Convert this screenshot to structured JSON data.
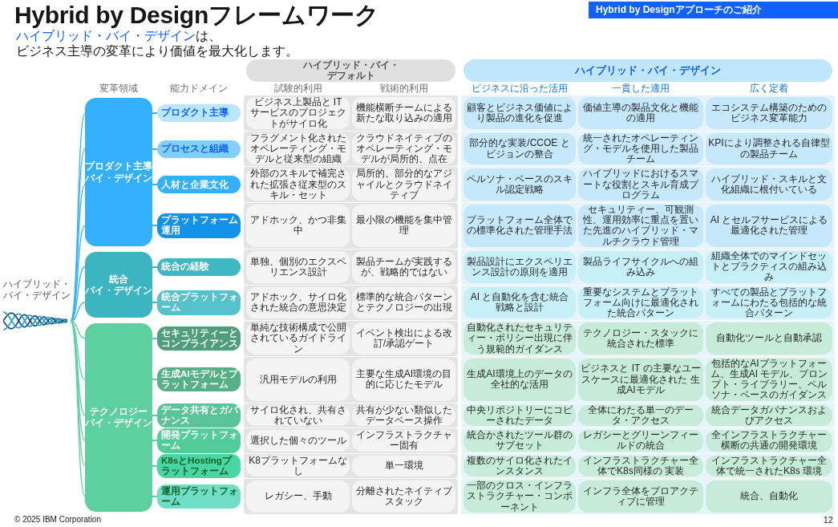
{
  "banner": "Hybrid by Designアプローチのご紹介",
  "title": "Hybrid by Designフレームワーク",
  "subtitle": {
    "emphasis": "ハイブリッド・バイ・デザイン",
    "rest": "は、",
    "line_2": "ビジネス主導の変革により価値を最大化します。"
  },
  "framework_label": [
    "ハイブリッド・",
    "バイ・デザイン"
  ],
  "axis_headers": {
    "areas": "変革領域",
    "domains": "能力ドメイン"
  },
  "maturity_groups": [
    {
      "kind": "default",
      "label_lines": [
        "ハイブリッド・バイ・",
        "デフォルト"
      ],
      "stages": [
        "試験的利用",
        "戦術的利用"
      ]
    },
    {
      "kind": "design",
      "label_lines": [
        "ハイブリッド・バイ・デザイン"
      ],
      "stages": [
        "ビジネスに沿った活用",
        "一貫した適用",
        "広く定着"
      ]
    }
  ],
  "areas": [
    {
      "kind": "product",
      "label_lines": [
        "プロダクト主導",
        "バイ・デザイン"
      ],
      "color": "#33b1ff",
      "domains": [
        {
          "label": "プロダクト主導",
          "color": "#bae6ff",
          "cells": [
            "ビジネス上製品と IT サービスのプロジェクトがサイロ化",
            "機能横断チームによる新たな取り込みの適用",
            "顧客とビジネス価値により製品の進化を促進",
            "価値主導の製品文化と機能の適用",
            "エコシステム構築のためのビジネス変革能力"
          ]
        },
        {
          "label": "プロセスと組織",
          "color": "#82cfff",
          "cells": [
            "フラグメント化されたオペレーティング・モデルと従来型の組織",
            "クラウドネイティブのオペレーティング・モデルが局所的、点在",
            "部分的な実装/CCOE とビジョンの整合",
            "統一されたオペレーティング・モデルを使用した製品チーム",
            "KPIにより調整される自律型の製品チーム"
          ]
        },
        {
          "label": "人材と企業文化",
          "color": "#33b1ff",
          "cells": [
            "外部のスキルで補完された拡張さ従来型のスキル・セット",
            "局所的、部分的なアジャイルとクラウドネイティブ",
            "ペルソナ・ベースのスキル認定戦略",
            "ハイブリッドにおけるスマートな役割とスキル育成プログラム",
            "ハイブリッド・スキルと文化組織に根付いている"
          ]
        },
        {
          "label": "プラットフォーム運用",
          "color": "#1192e8",
          "cells": [
            "アドホック、かつ非集中",
            "最小限の機能を集中管理",
            "プラットフォーム全体での標準化された管理手法",
            "セキュリティー、可観測性、運用効率に重点を置いた先進のハイブリッド・マルチクラウド管理",
            "AI とセルフサービスによる最適化された管理"
          ]
        }
      ]
    },
    {
      "kind": "integration",
      "label_lines": [
        "統合",
        "バイ・デザイン"
      ],
      "color": "#3db5c0",
      "domains": [
        {
          "label": "統合の経験",
          "color": "#3fb8c3",
          "cells": [
            "単独、個別のエクスペリエンス設計",
            "製品チームが実践するが、戦略的ではない",
            "製品設計にエクスペリエンス設計の原則を適用",
            "製品ライフサイクルへの組み込み",
            "組織全体でのマインドセットとプラクティスの組み込み"
          ]
        },
        {
          "label": "統合プラットフォーム",
          "color": "#56c1ca",
          "cells": [
            "アドホック、サイロ化された統合の意思決定",
            "標準的な統合パターンとテクノロジーの出現",
            "AI と自動化を含む統合戦略と設計",
            "重要なシステムとプラットフォーム向けに最適化された統合パターン",
            "すべての製品とプラットフォームにわたる包括的な統合パターン"
          ]
        }
      ]
    },
    {
      "kind": "technology",
      "label_lines": [
        "テクノロジー",
        "バイ・デザイン"
      ],
      "color": "#5ecf9f",
      "domains": [
        {
          "label": "セキュリティーとコンプライアンス",
          "color": "#4f9e7b",
          "cells": [
            "単純な技術構成で公開されているガイドライン",
            "イベント検出による改訂/承認ゲート",
            "自動化されたセキュリティー・ポリシー出現に伴う規範的ガイダンス",
            "テクノロジー・スタックに統合された標準",
            "自動化ツールと自動承認"
          ]
        },
        {
          "label": "生成AIモデルとプラットフォーム",
          "color": "#55b086",
          "cells": [
            "汎用モデルの利用",
            "主要な生成AI環境の目的に応じたモデル",
            "生成AI環境上のデータの全社的な活用",
            "ビジネスと IT の主要なユースケースに最適化された 生成AIモデル",
            "包括的なAIプラットフォーム、生成AI モデル、プロンプト・ライブラリー、ペルソナ・ベースのガイダンス"
          ]
        },
        {
          "label": "データ共有とガバナンス",
          "color": "#5ac39a",
          "cells": [
            "サイロ化され、共有されていない",
            "共有が少ない類似したデータベース操作",
            "中央リポジトリーにコピーされたデータ",
            "全体にわたる単一のデータ・アクセス",
            "統合データガバナンスおよびアクセス"
          ]
        },
        {
          "label": "開発プラットフォーム",
          "color": "#52cc98",
          "cells": [
            "選択した個々のツール",
            "インフラストラクチャー固有",
            "統合かされたツール群のサブセット",
            "レガシーとグリーンフィールドの統合",
            "全インフラストラクチャー横断の共通の開発環境"
          ]
        },
        {
          "label": "K8sとHostingプラットフォーム",
          "color": "#47d6a4",
          "cells": [
            "K8プラットフォームなし",
            "単一環境",
            "複数のサイロ化されたインスタンス",
            "インフラストラクチャー全体でK8s同様の 実装",
            "インフラストラクチャー全体で統一されたK8s 環境"
          ]
        },
        {
          "label": "運用プラットフォーム",
          "color": "#6fdec4",
          "cells": [
            "レガシー、手動",
            "分離されたネイティブスタック",
            "一部のクロス・インフラストラクチャー・コンポーネント",
            "インフラ全体をプロアクティブに管理",
            "統合、自動化"
          ]
        }
      ]
    }
  ],
  "footer": {
    "copyright": "© 2025 IBM Corporation",
    "page_number": "12"
  }
}
